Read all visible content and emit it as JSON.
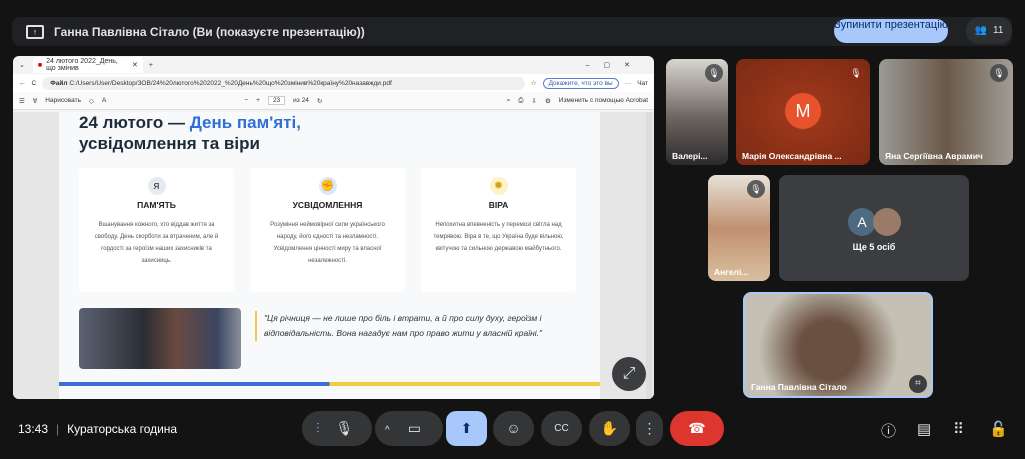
{
  "header": {
    "title": "Ганна Павлівна Сітало (Ви (показуєте презентацію))",
    "stop_label": "Зупинити презентацію",
    "people_count": "11"
  },
  "browser": {
    "tab_title": "24 лютого 2022_День, що змінив",
    "address_prefix": "Файл",
    "url": "C:/Users/User/Desktop/ЗОВ/24%20лютого%202022_%20День%20що%20змінив%20країну%20назавжди.pdf",
    "profile_label": "Докажите, что это вы",
    "copilot": "Чат",
    "draw_label": "Нарисовать",
    "page_current": "23",
    "page_total": "из 24",
    "acrobat_label": "Изменить с помощью Acrobat"
  },
  "slide": {
    "title_part1": "24 лютого — ",
    "title_part2": "День пам'яті,",
    "title_line2": "усвідомлення та віри",
    "cards": [
      {
        "icon": "ribbon-icon",
        "title": "ПАМ'ЯТЬ",
        "text": "Вшанування кожного, хто віддав життя за свободу. День скорботи за втраченим, але й гордості за героїзм наших захисників та захисниць."
      },
      {
        "icon": "fist-icon",
        "title": "УСВІДОМЛЕННЯ",
        "text": "Розуміння неймовірної сили українського народу, його єдності та незламності. Усвідомлення цінності миру та власної незалежності."
      },
      {
        "icon": "sun-icon",
        "title": "ВІРА",
        "text": "Непохитна впевненість у перемозі світла над темрявою. Віра в те, що Україна буде вільною, квітучою та сильною державою майбутнього."
      }
    ],
    "quote": "\"Ця річниця — не лише про біль і втрати, а й про силу духу, героїзм і відповідальність. Вона нагадує нам про право жити у власній країні.\""
  },
  "participants": [
    {
      "name": "Валері...",
      "muted": true
    },
    {
      "name": "Марія Олександрівна ...",
      "initial": "M",
      "muted": true
    },
    {
      "name": "Яна Сергіївна Аврамич",
      "muted": true
    },
    {
      "name": "Ангелі...",
      "muted": true
    },
    {
      "more": "Ще 5 осіб",
      "initial": "A"
    },
    {
      "name": "Ганна Павлівна Сітало"
    }
  ],
  "footer": {
    "time": "13:43",
    "meeting": "Кураторська година"
  },
  "colors": {
    "accent": "#a8c7fa",
    "end_call": "#dc362e",
    "avatar_m": "#e8532d"
  }
}
